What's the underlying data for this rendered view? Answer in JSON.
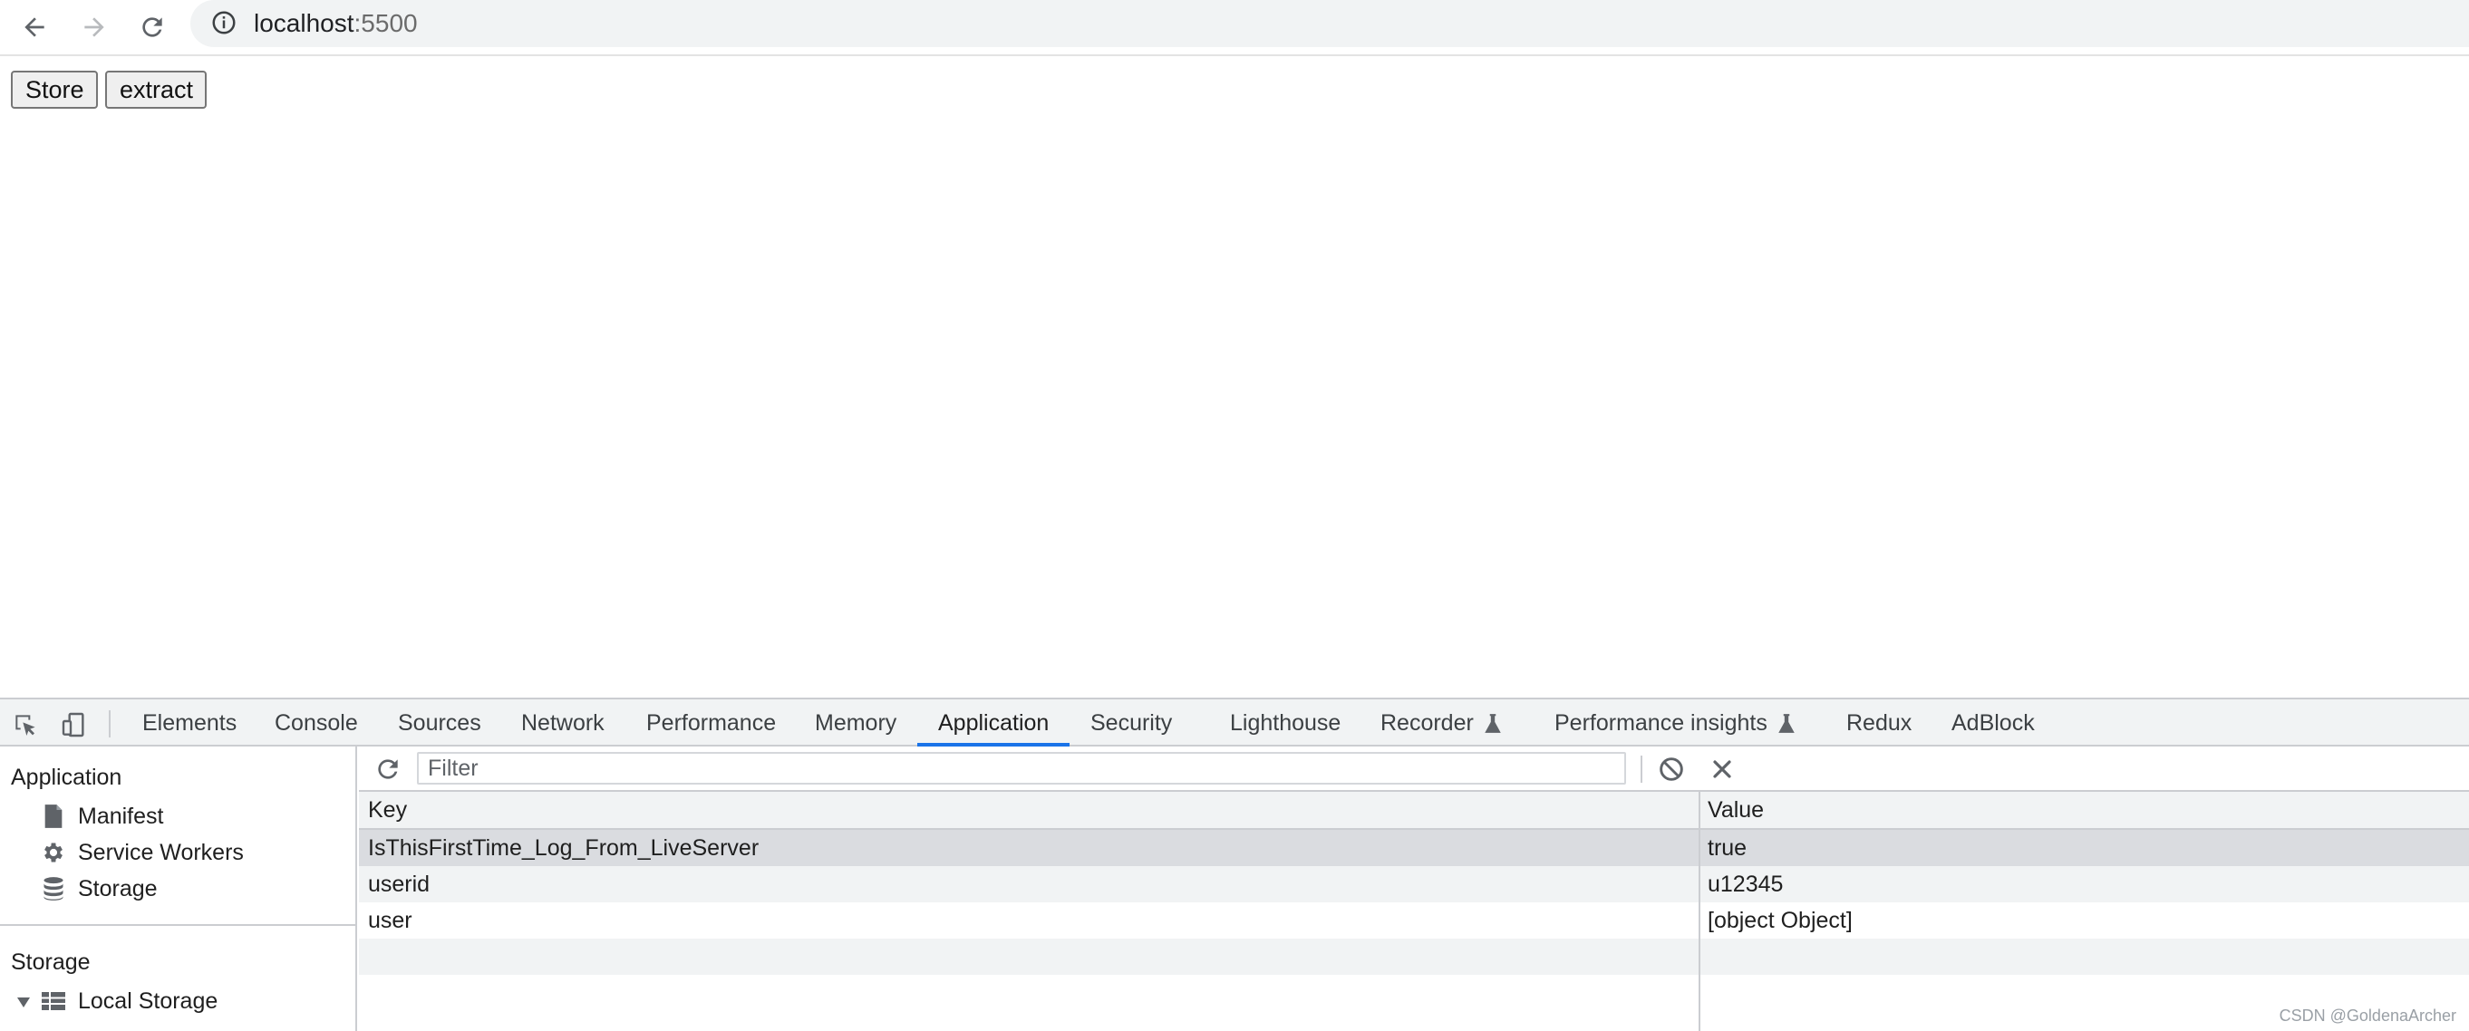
{
  "browser": {
    "url_host": "localhost",
    "url_port": ":5500",
    "icons": {
      "back": "arrow-left-icon",
      "forward": "arrow-right-icon",
      "reload": "reload-icon",
      "info": "info-icon"
    }
  },
  "page": {
    "buttons": {
      "store": "Store",
      "extract": "extract"
    }
  },
  "devtools": {
    "tabs": [
      {
        "label": "Elements"
      },
      {
        "label": "Console"
      },
      {
        "label": "Sources"
      },
      {
        "label": "Network"
      },
      {
        "label": "Performance"
      },
      {
        "label": "Memory"
      },
      {
        "label": "Application",
        "active": true
      },
      {
        "label": "Security"
      },
      {
        "label": "Lighthouse"
      },
      {
        "label": "Recorder",
        "icon": "flask-icon"
      },
      {
        "label": "Performance insights",
        "icon": "flask-icon"
      },
      {
        "label": "Redux"
      },
      {
        "label": "AdBlock"
      }
    ],
    "accent_color": "#1a73e8",
    "sidebar": {
      "application_header": "Application",
      "application_items": [
        {
          "label": "Manifest",
          "icon": "document-icon"
        },
        {
          "label": "Service Workers",
          "icon": "gear-icon"
        },
        {
          "label": "Storage",
          "icon": "database-icon"
        }
      ],
      "storage_header": "Storage",
      "storage_items": [
        {
          "label": "Local Storage",
          "icon": "grid-icon",
          "expanded": true
        }
      ]
    },
    "storage_panel": {
      "filter_placeholder": "Filter",
      "columns": {
        "key": "Key",
        "value": "Value"
      },
      "rows": [
        {
          "key": "IsThisFirstTime_Log_From_LiveServer",
          "value": "true",
          "selected": true
        },
        {
          "key": "userid",
          "value": "u12345"
        },
        {
          "key": "user",
          "value": "[object Object]"
        }
      ]
    }
  },
  "watermark": "CSDN @GoldenaArcher"
}
